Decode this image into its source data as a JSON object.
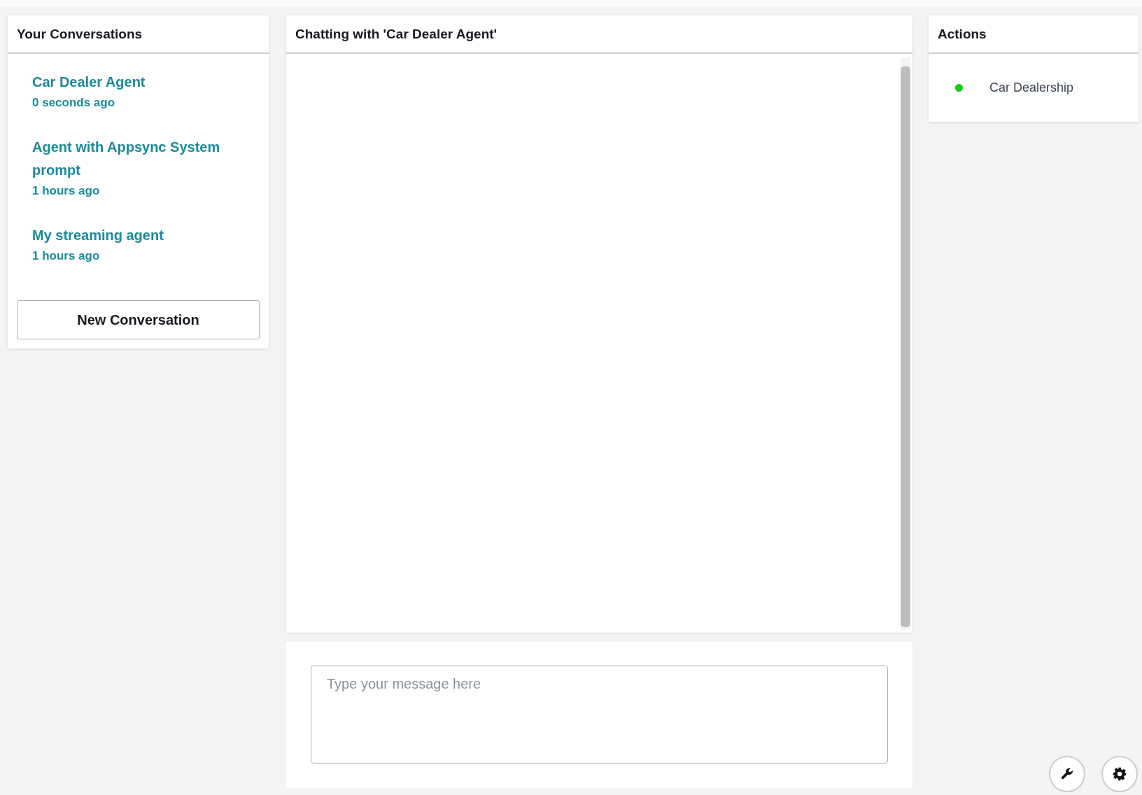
{
  "conversations": {
    "title": "Your Conversations",
    "items": [
      {
        "name": "Car Dealer Agent",
        "time": "0 seconds ago"
      },
      {
        "name": "Agent with Appsync System prompt",
        "time": "1 hours ago"
      },
      {
        "name": "My streaming agent",
        "time": "1 hours ago"
      }
    ],
    "new_button": "New Conversation"
  },
  "chat": {
    "title": "Chatting with 'Car Dealer Agent'",
    "input": {
      "placeholder": "Type your message here"
    }
  },
  "actions": {
    "title": "Actions",
    "items": [
      {
        "label": "Car Dealership",
        "color": "#11cc11"
      }
    ]
  },
  "floating_buttons": [
    {
      "kind": "wrench"
    },
    {
      "kind": "gear"
    }
  ]
}
